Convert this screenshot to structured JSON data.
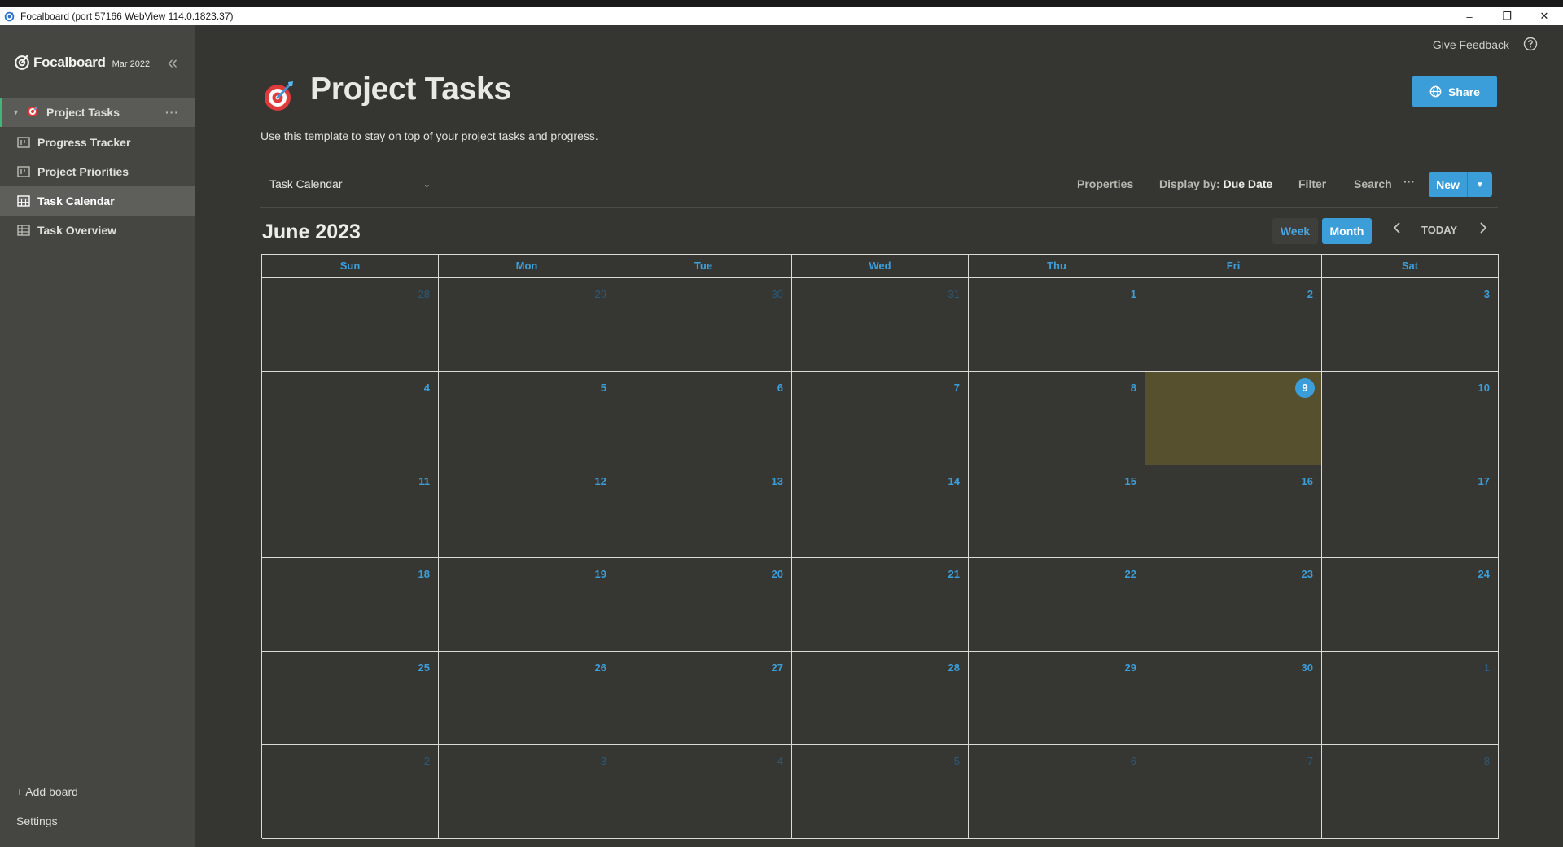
{
  "window": {
    "title": "Focalboard (port 57166 WebView 114.0.1823.37)",
    "minimize": "–",
    "restore": "❐",
    "close": "✕"
  },
  "sidebar": {
    "brand_name": "Focalboard",
    "brand_version": "Mar 2022",
    "collapse_glyph": "«",
    "parent_board": {
      "label": "Project Tasks",
      "icon": "target-emoji-icon",
      "menu": "···"
    },
    "views": [
      {
        "label": "Progress Tracker",
        "icon": "board-view-icon"
      },
      {
        "label": "Project Priorities",
        "icon": "board-view-icon"
      },
      {
        "label": "Task Calendar",
        "icon": "calendar-view-icon",
        "active": true
      },
      {
        "label": "Task Overview",
        "icon": "table-view-icon"
      }
    ],
    "add_board": "+ Add board",
    "settings": "Settings"
  },
  "header": {
    "give_feedback": "Give Feedback",
    "title": "Project Tasks",
    "description": "Use this template to stay on top of your project tasks and progress.",
    "share_label": "Share"
  },
  "view_header": {
    "view_name": "Task Calendar",
    "properties": "Properties",
    "display_by_label": "Display by:",
    "display_by_value": "Due Date",
    "filter": "Filter",
    "search": "Search",
    "more": "···",
    "new_label": "New"
  },
  "calendar": {
    "month_title": "June 2023",
    "week_label": "Week",
    "month_label": "Month",
    "today_label": "TODAY",
    "prev_glyph": "‹",
    "next_glyph": "›",
    "days_of_week": [
      "Sun",
      "Mon",
      "Tue",
      "Wed",
      "Thu",
      "Fri",
      "Sat"
    ],
    "today": 9,
    "weeks": [
      [
        {
          "d": "28",
          "o": true
        },
        {
          "d": "29",
          "o": true
        },
        {
          "d": "30",
          "o": true
        },
        {
          "d": "31",
          "o": true
        },
        {
          "d": "1"
        },
        {
          "d": "2"
        },
        {
          "d": "3"
        }
      ],
      [
        {
          "d": "4"
        },
        {
          "d": "5"
        },
        {
          "d": "6"
        },
        {
          "d": "7"
        },
        {
          "d": "8"
        },
        {
          "d": "9",
          "t": true
        },
        {
          "d": "10"
        }
      ],
      [
        {
          "d": "11"
        },
        {
          "d": "12"
        },
        {
          "d": "13"
        },
        {
          "d": "14"
        },
        {
          "d": "15"
        },
        {
          "d": "16"
        },
        {
          "d": "17"
        }
      ],
      [
        {
          "d": "18"
        },
        {
          "d": "19"
        },
        {
          "d": "20"
        },
        {
          "d": "21"
        },
        {
          "d": "22"
        },
        {
          "d": "23"
        },
        {
          "d": "24"
        }
      ],
      [
        {
          "d": "25"
        },
        {
          "d": "26"
        },
        {
          "d": "27"
        },
        {
          "d": "28"
        },
        {
          "d": "29"
        },
        {
          "d": "30"
        },
        {
          "d": "1",
          "o": true
        }
      ],
      [
        {
          "d": "2",
          "o": true
        },
        {
          "d": "3",
          "o": true
        },
        {
          "d": "4",
          "o": true
        },
        {
          "d": "5",
          "o": true
        },
        {
          "d": "6",
          "o": true
        },
        {
          "d": "7",
          "o": true
        },
        {
          "d": "8",
          "o": true
        }
      ]
    ]
  },
  "colors": {
    "accent": "#3c9ed9",
    "sidebar_bg": "#454541",
    "main_bg": "#353532",
    "today_bg": "#57502f",
    "active_indicator": "#42b47c"
  }
}
